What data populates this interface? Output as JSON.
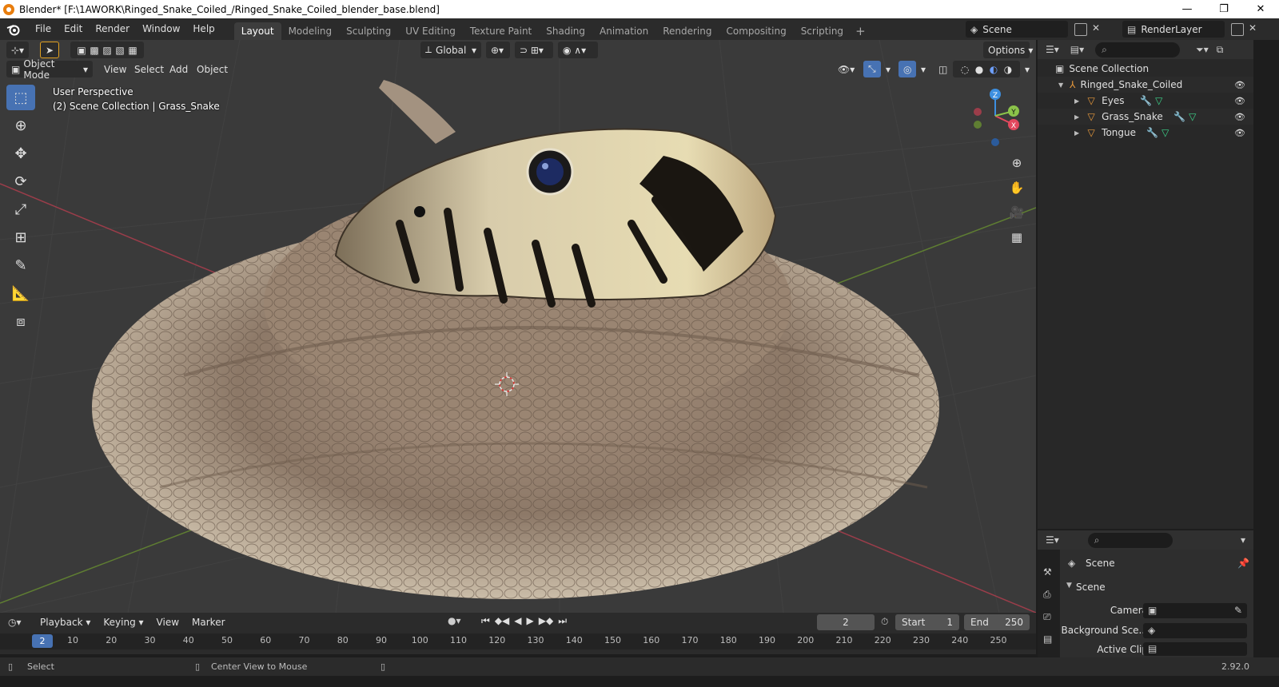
{
  "window": {
    "title": "Blender* [F:\\1AWORK\\Ringed_Snake_Coiled_/Ringed_Snake_Coiled_blender_base.blend]",
    "minimize": "—",
    "restore": "❐",
    "close": "✕"
  },
  "menu": {
    "items": [
      "File",
      "Edit",
      "Render",
      "Window",
      "Help"
    ]
  },
  "workspaces": {
    "tabs": [
      "Layout",
      "Modeling",
      "Sculpting",
      "UV Editing",
      "Texture Paint",
      "Shading",
      "Animation",
      "Rendering",
      "Compositing",
      "Scripting"
    ],
    "active": "Layout",
    "add": "+"
  },
  "scene_selector": {
    "value": "Scene"
  },
  "layer_selector": {
    "value": "RenderLayer"
  },
  "viewport": {
    "mode": "Object Mode",
    "menus": [
      "View",
      "Select",
      "Add",
      "Object"
    ],
    "transform_orientation": "Global",
    "options": "Options",
    "perspective_label": "User Perspective",
    "collection_label": "(2) Scene Collection | Grass_Snake",
    "gizmo_axes": [
      "X",
      "Y",
      "Z"
    ]
  },
  "timeline": {
    "menus": [
      "Playback",
      "Keying",
      "View",
      "Marker"
    ],
    "current_frame": "2",
    "start_label": "Start",
    "start_value": "1",
    "end_label": "End",
    "end_value": "250",
    "ruler_current": "2",
    "ruler_ticks": [
      "10",
      "20",
      "30",
      "40",
      "50",
      "60",
      "70",
      "80",
      "90",
      "100",
      "110",
      "120",
      "130",
      "140",
      "150",
      "160",
      "170",
      "180",
      "190",
      "200",
      "210",
      "220",
      "230",
      "240",
      "250"
    ]
  },
  "status": {
    "select": "Select",
    "center_view": "Center View to Mouse",
    "version": "2.92.0"
  },
  "outliner": {
    "root": "Scene Collection",
    "collection": "Ringed_Snake_Coiled",
    "objects": [
      "Eyes",
      "Grass_Snake",
      "Tongue"
    ]
  },
  "properties": {
    "context": "Scene",
    "panel": "Scene",
    "fields": [
      {
        "label": "Camera"
      },
      {
        "label": "Background Sce..."
      },
      {
        "label": "Active Clip"
      }
    ]
  },
  "colors": {
    "accent": "#4772b3",
    "viewport_bg": "#3a3a3a",
    "axis_x": "#e2485e",
    "axis_y": "#8bc34a",
    "axis_z": "#3d8fe0"
  }
}
